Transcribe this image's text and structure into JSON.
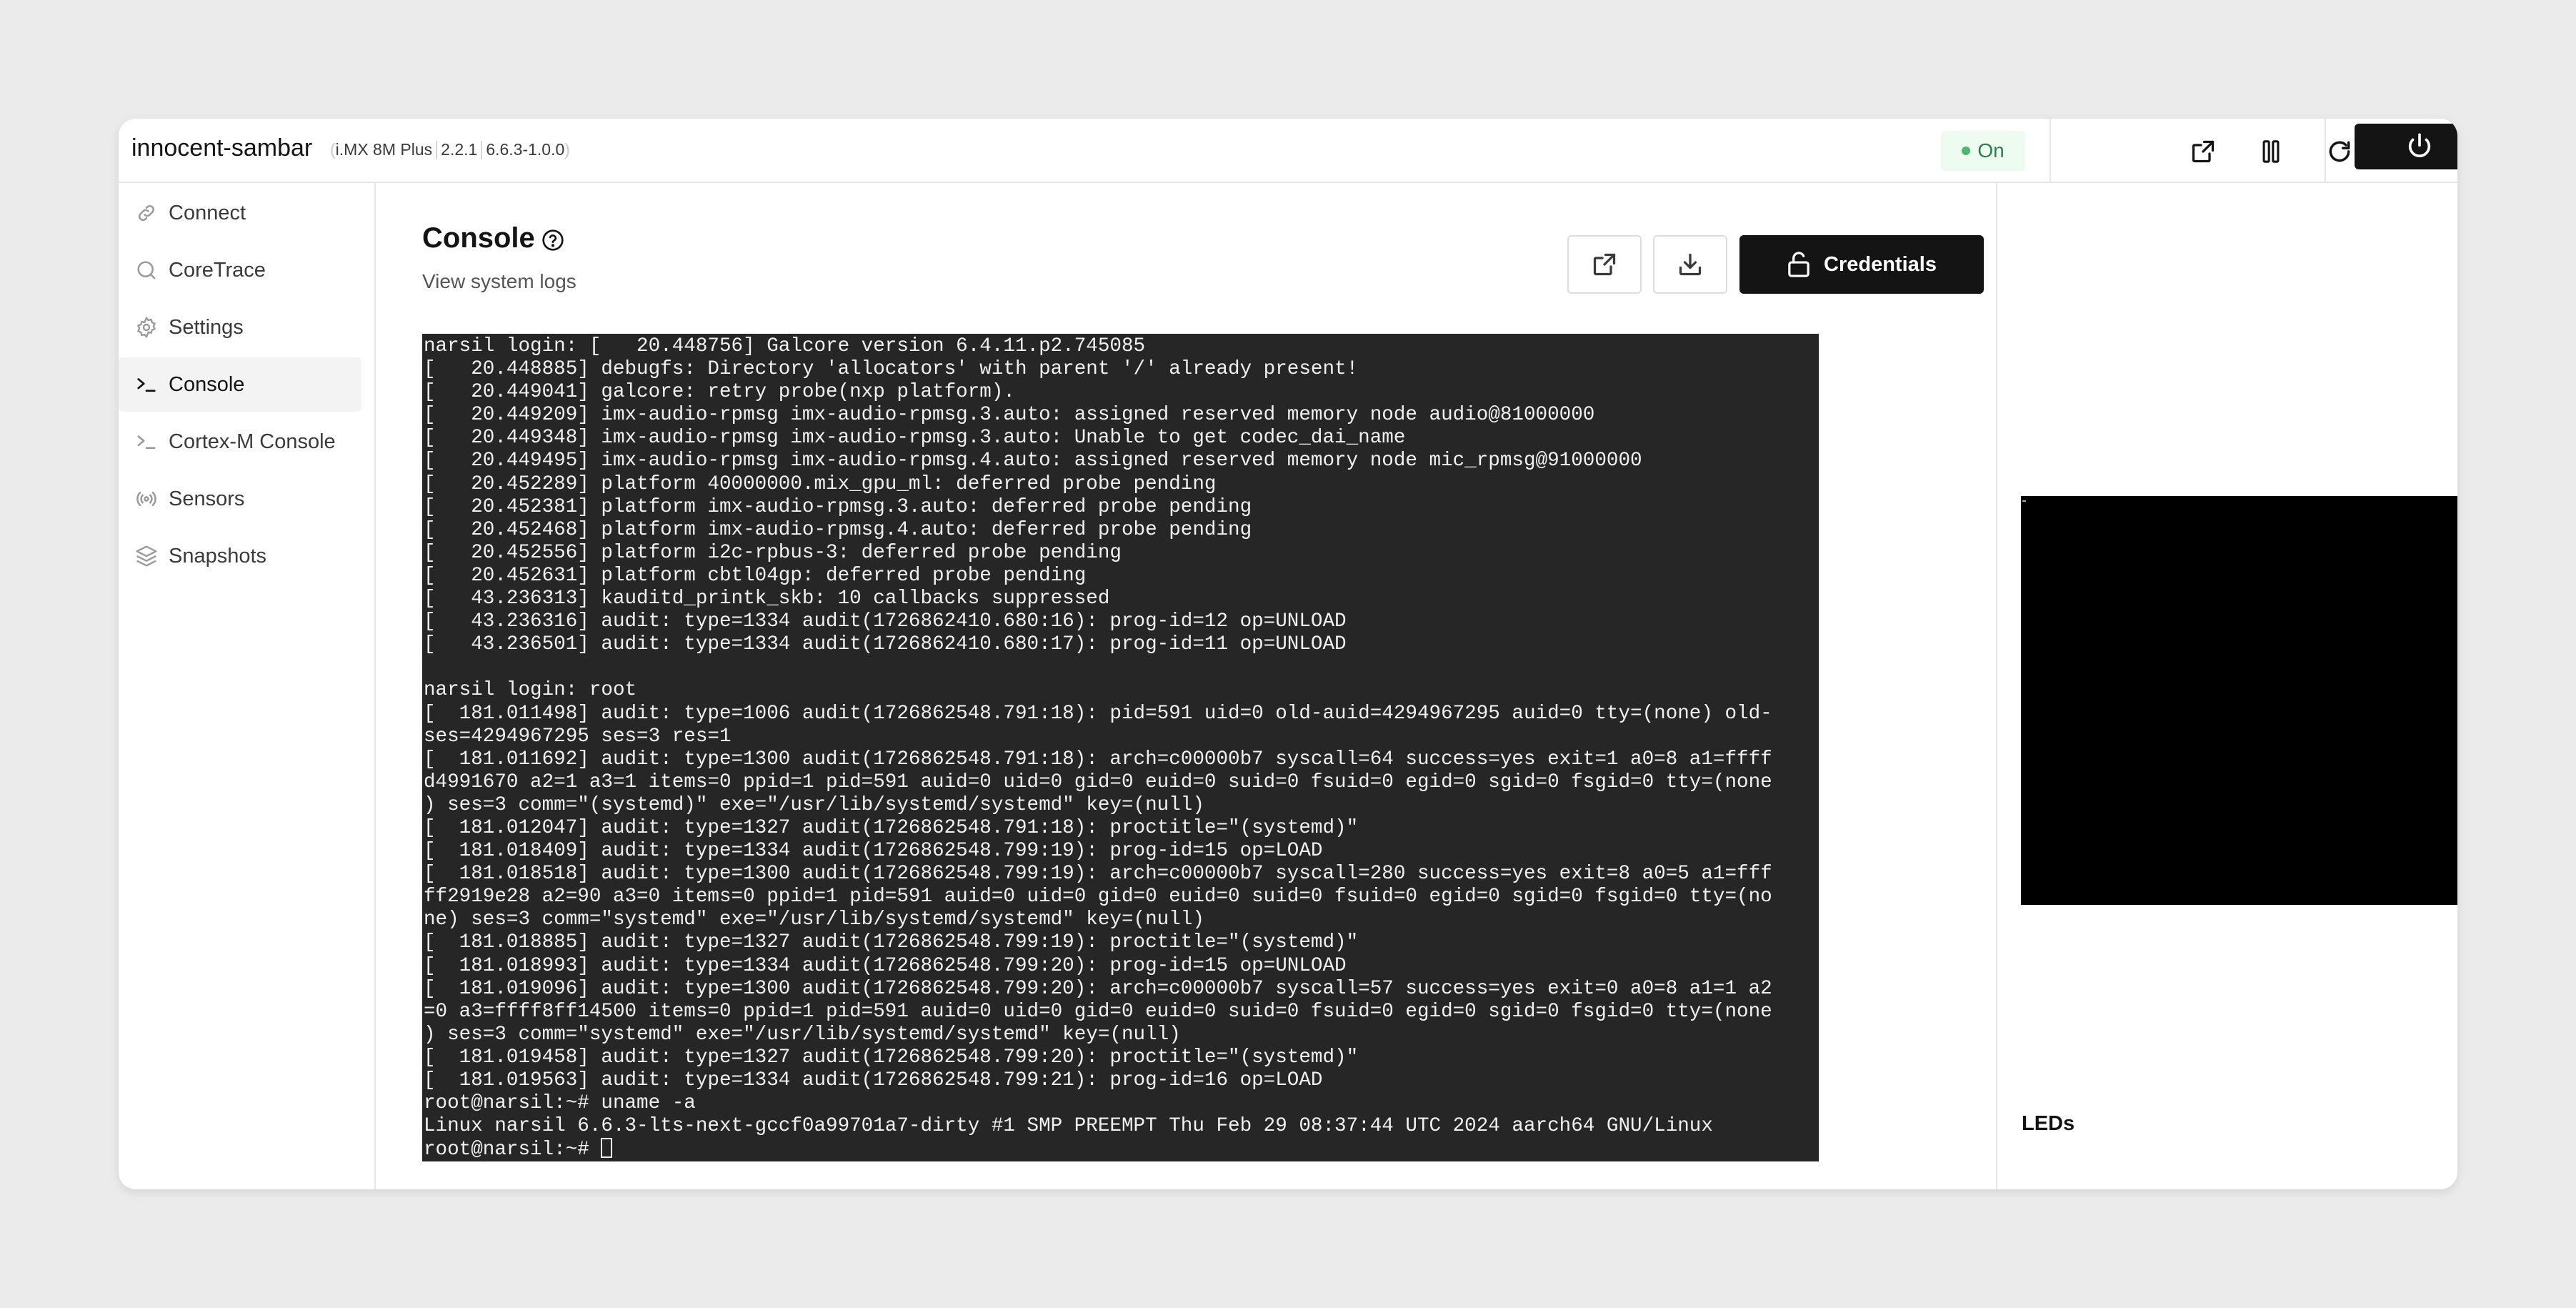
{
  "header": {
    "device_name": "innocent-sambar",
    "meta": {
      "board": "i.MX 8M Plus",
      "version": "2.2.1",
      "bsp": "6.6.3-1.0.0"
    },
    "status": {
      "label": "On",
      "color": "#4cb86e"
    },
    "actions": [
      {
        "name": "open-external",
        "icon": "external-link-icon"
      },
      {
        "name": "pause",
        "icon": "pause-icon"
      },
      {
        "name": "restart",
        "icon": "refresh-icon"
      },
      {
        "name": "delete",
        "icon": "trash-icon",
        "color": "#d0392b"
      }
    ],
    "power": {
      "icon": "power-icon"
    }
  },
  "sidebar": {
    "items": [
      {
        "label": "Connect",
        "icon": "link-icon",
        "active": false
      },
      {
        "label": "CoreTrace",
        "icon": "search-icon",
        "active": false
      },
      {
        "label": "Settings",
        "icon": "gear-icon",
        "active": false
      },
      {
        "label": "Console",
        "icon": "terminal-icon",
        "active": true
      },
      {
        "label": "Cortex-M Console",
        "icon": "terminal-icon",
        "active": false
      },
      {
        "label": "Sensors",
        "icon": "broadcast-icon",
        "active": false
      },
      {
        "label": "Snapshots",
        "icon": "layers-icon",
        "active": false
      }
    ]
  },
  "main": {
    "title": "Console",
    "subtitle": "View system logs",
    "buttons": {
      "open_external_icon": "external-link-icon",
      "download_icon": "download-icon",
      "credentials_label": "Credentials",
      "credentials_icon": "unlock-icon"
    },
    "terminal": {
      "lines": [
        "narsil login: [   20.448756] Galcore version 6.4.11.p2.745085",
        "[   20.448885] debugfs: Directory 'allocators' with parent '/' already present!",
        "[   20.449041] galcore: retry probe(nxp platform).",
        "[   20.449209] imx-audio-rpmsg imx-audio-rpmsg.3.auto: assigned reserved memory node audio@81000000",
        "[   20.449348] imx-audio-rpmsg imx-audio-rpmsg.3.auto: Unable to get codec_dai_name",
        "[   20.449495] imx-audio-rpmsg imx-audio-rpmsg.4.auto: assigned reserved memory node mic_rpmsg@91000000",
        "[   20.452289] platform 40000000.mix_gpu_ml: deferred probe pending",
        "[   20.452381] platform imx-audio-rpmsg.3.auto: deferred probe pending",
        "[   20.452468] platform imx-audio-rpmsg.4.auto: deferred probe pending",
        "[   20.452556] platform i2c-rpbus-3: deferred probe pending",
        "[   20.452631] platform cbtl04gp: deferred probe pending",
        "[   43.236313] kauditd_printk_skb: 10 callbacks suppressed",
        "[   43.236316] audit: type=1334 audit(1726862410.680:16): prog-id=12 op=UNLOAD",
        "[   43.236501] audit: type=1334 audit(1726862410.680:17): prog-id=11 op=UNLOAD",
        "",
        "narsil login: root",
        "[  181.011498] audit: type=1006 audit(1726862548.791:18): pid=591 uid=0 old-auid=4294967295 auid=0 tty=(none) old-",
        "ses=4294967295 ses=3 res=1",
        "[  181.011692] audit: type=1300 audit(1726862548.791:18): arch=c00000b7 syscall=64 success=yes exit=1 a0=8 a1=ffff",
        "d4991670 a2=1 a3=1 items=0 ppid=1 pid=591 auid=0 uid=0 gid=0 euid=0 suid=0 fsuid=0 egid=0 sgid=0 fsgid=0 tty=(none",
        ") ses=3 comm=\"(systemd)\" exe=\"/usr/lib/systemd/systemd\" key=(null)",
        "[  181.012047] audit: type=1327 audit(1726862548.791:18): proctitle=\"(systemd)\"",
        "[  181.018409] audit: type=1334 audit(1726862548.799:19): prog-id=15 op=LOAD",
        "[  181.018518] audit: type=1300 audit(1726862548.799:19): arch=c00000b7 syscall=280 success=yes exit=8 a0=5 a1=fff",
        "ff2919e28 a2=90 a3=0 items=0 ppid=1 pid=591 auid=0 uid=0 gid=0 euid=0 suid=0 fsuid=0 egid=0 sgid=0 fsgid=0 tty=(no",
        "ne) ses=3 comm=\"systemd\" exe=\"/usr/lib/systemd/systemd\" key=(null)",
        "[  181.018885] audit: type=1327 audit(1726862548.799:19): proctitle=\"(systemd)\"",
        "[  181.018993] audit: type=1334 audit(1726862548.799:20): prog-id=15 op=UNLOAD",
        "[  181.019096] audit: type=1300 audit(1726862548.799:20): arch=c00000b7 syscall=57 success=yes exit=0 a0=8 a1=1 a2",
        "=0 a3=ffff8ff14500 items=0 ppid=1 pid=591 auid=0 uid=0 gid=0 euid=0 suid=0 fsuid=0 egid=0 sgid=0 fsgid=0 tty=(none",
        ") ses=3 comm=\"systemd\" exe=\"/usr/lib/systemd/systemd\" key=(null)",
        "[  181.019458] audit: type=1327 audit(1726862548.799:20): proctitle=\"(systemd)\"",
        "[  181.019563] audit: type=1334 audit(1726862548.799:21): prog-id=16 op=LOAD",
        "root@narsil:~# uname -a",
        "Linux narsil 6.6.3-lts-next-gccf0a99701a7-dirty #1 SMP PREEMPT Thu Feb 29 08:37:44 UTC 2024 aarch64 GNU/Linux"
      ],
      "prompt": "root@narsil:~# "
    }
  },
  "right_panel": {
    "leds_title": "LEDs",
    "led_color": "#6dd18f"
  }
}
